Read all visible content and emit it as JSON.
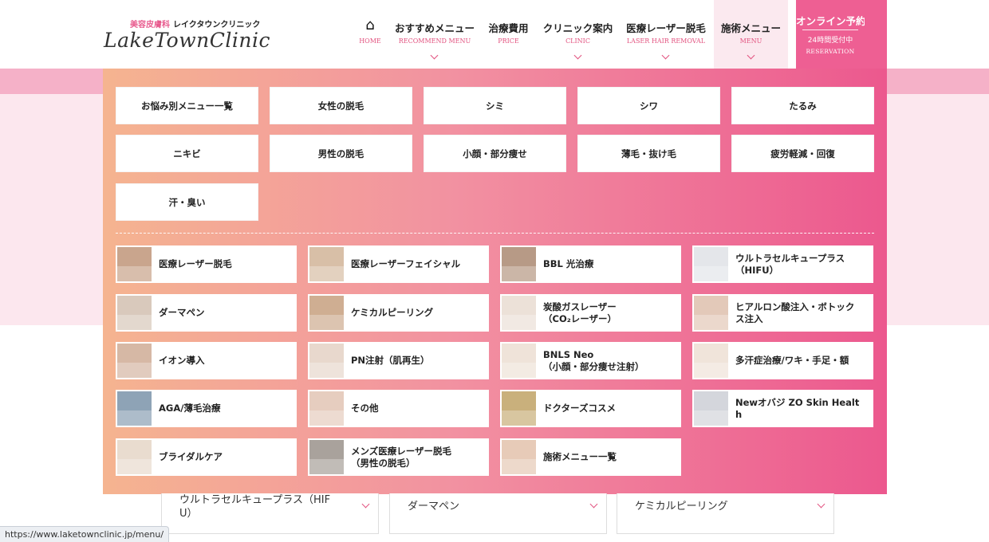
{
  "header": {
    "logo_sub_accent": "美容皮膚科",
    "logo_sub": "レイクタウンクリニック",
    "logo_main": "LakeTownClinic",
    "nav": [
      {
        "ja": "",
        "en": "HOME"
      },
      {
        "ja": "おすすめメニュー",
        "en": "RECOMMEND MENU"
      },
      {
        "ja": "治療費用",
        "en": "PRICE"
      },
      {
        "ja": "クリニック案内",
        "en": "CLINIC"
      },
      {
        "ja": "医療レーザー脱毛",
        "en": "LASER HAIR REMOVAL"
      },
      {
        "ja": "施術メニュー",
        "en": "MENU"
      }
    ],
    "reserve": {
      "title": "オンライン予約",
      "sub": "24時間受付中",
      "en": "RESERVATION"
    }
  },
  "mega_menu": {
    "categories": [
      "お悩み別メニュー一覧",
      "女性の脱毛",
      "シミ",
      "シワ",
      "たるみ",
      "ニキビ",
      "男性の脱毛",
      "小顔・部分痩せ",
      "薄毛・抜け毛",
      "疲労軽減・回復",
      "汗・臭い"
    ],
    "treatments": [
      {
        "label": "医療レーザー脱毛",
        "thumb": "#c9a58d"
      },
      {
        "label": "医療レーザーフェイシャル",
        "thumb": "#d8bfa7"
      },
      {
        "label": "BBL 光治療",
        "thumb": "#b79a86"
      },
      {
        "label": "ウルトラセルキュープラス\n（HIFU）",
        "thumb": "#e4e6ea"
      },
      {
        "label": "ダーマペン",
        "thumb": "#d9c9bc"
      },
      {
        "label": "ケミカルピーリング",
        "thumb": "#cfae92"
      },
      {
        "label": "炭酸ガスレーザー\n（CO₂レーザー）",
        "thumb": "#ece1d8"
      },
      {
        "label": "ヒアルロン酸注入・ボトック\nス注入",
        "thumb": "#e3c9b9"
      },
      {
        "label": "イオン導入",
        "thumb": "#d6b8a5"
      },
      {
        "label": "PN注射（肌再生）",
        "thumb": "#e8d8cd"
      },
      {
        "label": "BNLS Neo\n（小顔・部分痩せ注射）",
        "thumb": "#efe3d9"
      },
      {
        "label": "多汗症治療/ワキ・手足・額",
        "thumb": "#f0e4da"
      },
      {
        "label": "AGA/薄毛治療",
        "thumb": "#8ea3b6"
      },
      {
        "label": "その他",
        "thumb": "#e6cdbf"
      },
      {
        "label": "ドクターズコスメ",
        "thumb": "#c9b07c"
      },
      {
        "label": "Newオバジ ZO Skin Healt\nh",
        "thumb": "#d4d6dc"
      },
      {
        "label": "ブライダルケア",
        "thumb": "#e9dccf"
      },
      {
        "label": "メンズ医療レーザー脱毛\n（男性の脱毛）",
        "thumb": "#a9a29c"
      },
      {
        "label": "施術メニュー一覧",
        "thumb": "#e7cbb8"
      }
    ]
  },
  "below_items": [
    "ウルトラセルキュープラス（HIF\nU）",
    "ダーマペン",
    "ケミカルピーリング"
  ],
  "status_url": "https://www.laketownclinic.jp/menu/"
}
